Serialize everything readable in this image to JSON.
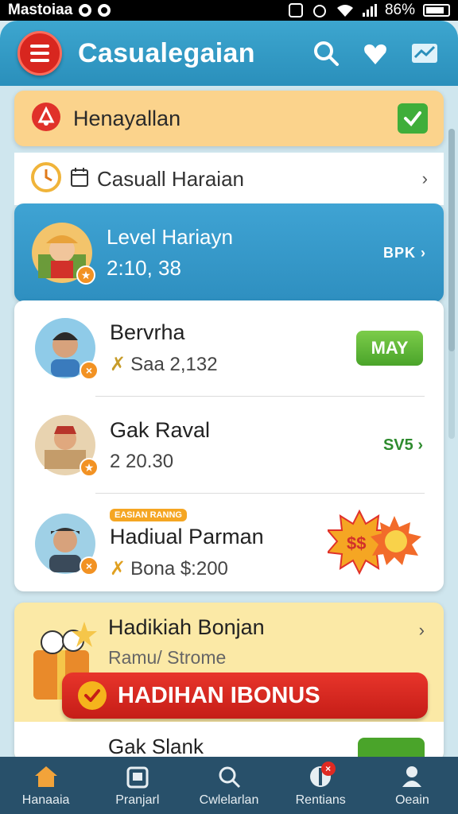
{
  "status_bar": {
    "carrier": "Mastoiaa",
    "battery": "86%"
  },
  "app_bar": {
    "title": "Casualegaian",
    "accent": "#2a8fbb",
    "menu_color": "#d8261f"
  },
  "top_banner": {
    "title": "Henayallan",
    "checked": true
  },
  "casual_row": {
    "label": "Casuall Haraian"
  },
  "level_card": {
    "title": "Level Hariayn",
    "value": "2:10, 38",
    "right_label": "BPK"
  },
  "list": [
    {
      "name": "Bervrha",
      "sub": "Saa 2,132",
      "action": "MAY"
    },
    {
      "name": "Gak Raval",
      "sub": "2 20.30",
      "price": "SV5"
    },
    {
      "tag": "EASIAN RANNG",
      "name": "Hadiual Parman",
      "sub": "Bona $:200"
    }
  ],
  "bonus": {
    "head": "Hadikiah Bonjan",
    "subhead": "Ramu/ Strome",
    "button": "HADIHAN IBONUS"
  },
  "peek_row": {
    "name": "Gak Slank"
  },
  "bottom_nav": [
    {
      "label": "Hanaaia",
      "icon": "home-icon",
      "active": true
    },
    {
      "label": "Pranjarl",
      "icon": "calendar-icon"
    },
    {
      "label": "Cwlelarlan",
      "icon": "search-icon"
    },
    {
      "label": "Rentians",
      "icon": "shield-icon",
      "badge": "×"
    },
    {
      "label": "Oeain",
      "icon": "profile-icon"
    }
  ]
}
